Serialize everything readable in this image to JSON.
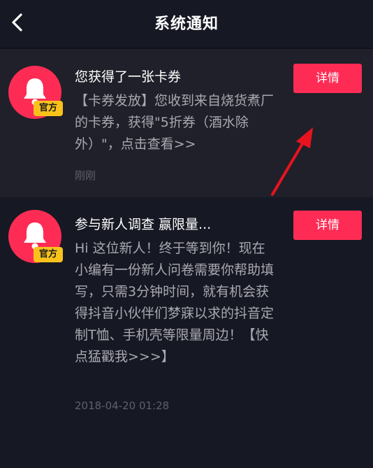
{
  "header": {
    "title": "系统通知"
  },
  "messages": [
    {
      "avatar_icon": "bell-icon",
      "badge": "官方",
      "title": "您获得了一张卡券",
      "body": "【卡券发放】您收到来自烧货煮厂的卡券，获得\"5折券（酒水除外）\"，点击查看>>",
      "time": "刚刚",
      "button_label": "详情"
    },
    {
      "avatar_icon": "bell-icon",
      "badge": "官方",
      "title": "参与新人调查 赢限量...",
      "body": "Hi 这位新人！终于等到你！现在小编有一份新人问卷需要你帮助填写，只需3分钟时间，就有机会获得抖音小伙伴们梦寐以求的抖音定制T恤、手机壳等限量周边！【快点猛戳我>>>】",
      "time": "2018-04-20 01:28",
      "button_label": "详情"
    }
  ],
  "colors": {
    "background": "#161823",
    "highlight_card": "#1f2029",
    "accent": "#fe2c55",
    "badge": "#f9c21b",
    "annotation_arrow": "#e8131f"
  }
}
